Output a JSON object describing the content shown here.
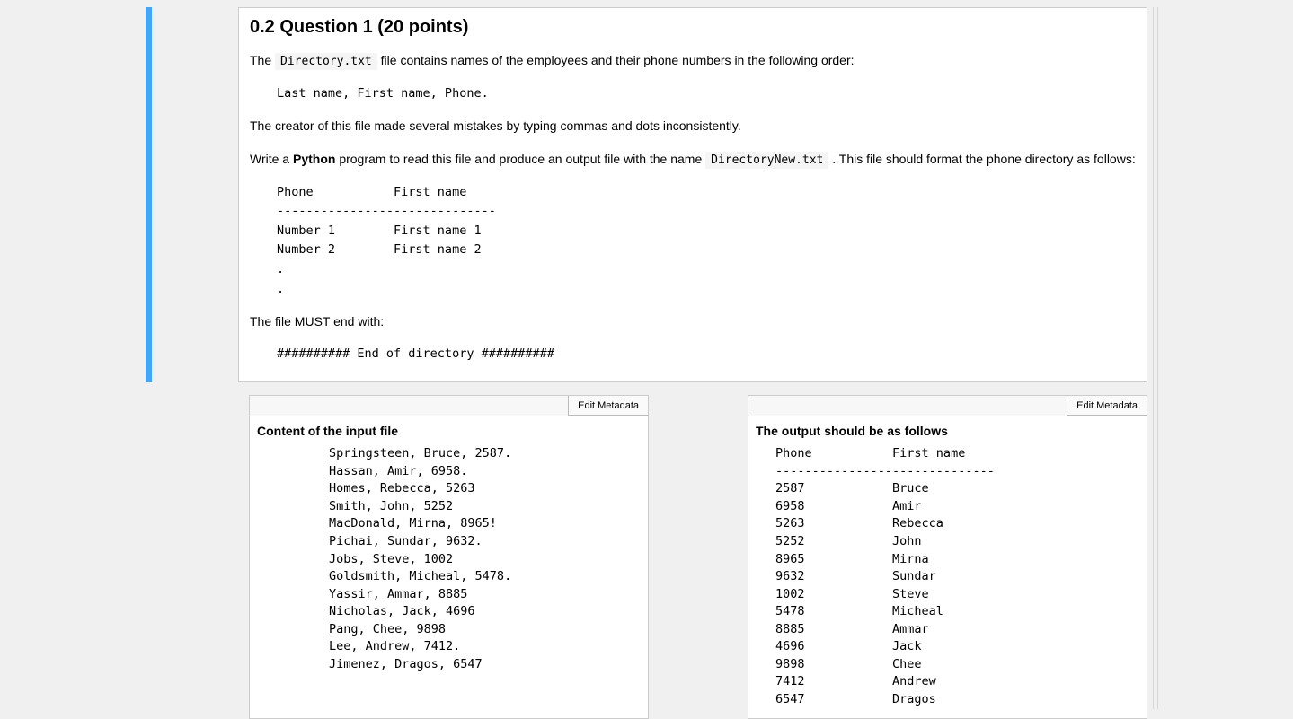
{
  "question": {
    "heading": "0.2  Question 1 (20 points)",
    "p1_pre": "The ",
    "p1_code": "Directory.txt",
    "p1_post": " file contains names of the employees and their phone numbers in the following order:",
    "fmt_line": "Last name, First name, Phone.",
    "p2": "The creator of this file made several mistakes by typing commas and dots inconsistently.",
    "p3_pre": "Write a ",
    "p3_bold": "Python",
    "p3_mid": " program to read this file and produce an output file with the name ",
    "p3_code": "DirectoryNew.txt",
    "p3_post": " . This file should format the phone directory as follows:",
    "sample_block": "Phone           First name\n------------------------------\nNumber 1        First name 1\nNumber 2        First name 2\n.\n.",
    "p4": "The file MUST end with:",
    "end_line": "########## End of directory ##########"
  },
  "left": {
    "edit_label": "Edit Metadata",
    "title": "Content of the input file",
    "content": "Springsteen, Bruce, 2587.\nHassan, Amir, 6958.\nHomes, Rebecca, 5263\nSmith, John, 5252\nMacDonald, Mirna, 8965!\nPichai, Sundar, 9632.\nJobs, Steve, 1002\nGoldsmith, Micheal, 5478.\nYassir, Ammar, 8885\nNicholas, Jack, 4696\nPang, Chee, 9898\nLee, Andrew, 7412.\nJimenez, Dragos, 6547"
  },
  "right": {
    "edit_label": "Edit Metadata",
    "title": "The output should be as follows",
    "content": "Phone           First name\n------------------------------\n2587            Bruce\n6958            Amir\n5263            Rebecca\n5252            John\n8965            Mirna\n9632            Sundar\n1002            Steve\n5478            Micheal\n8885            Ammar\n4696            Jack\n9898            Chee\n7412            Andrew\n6547            Dragos"
  }
}
